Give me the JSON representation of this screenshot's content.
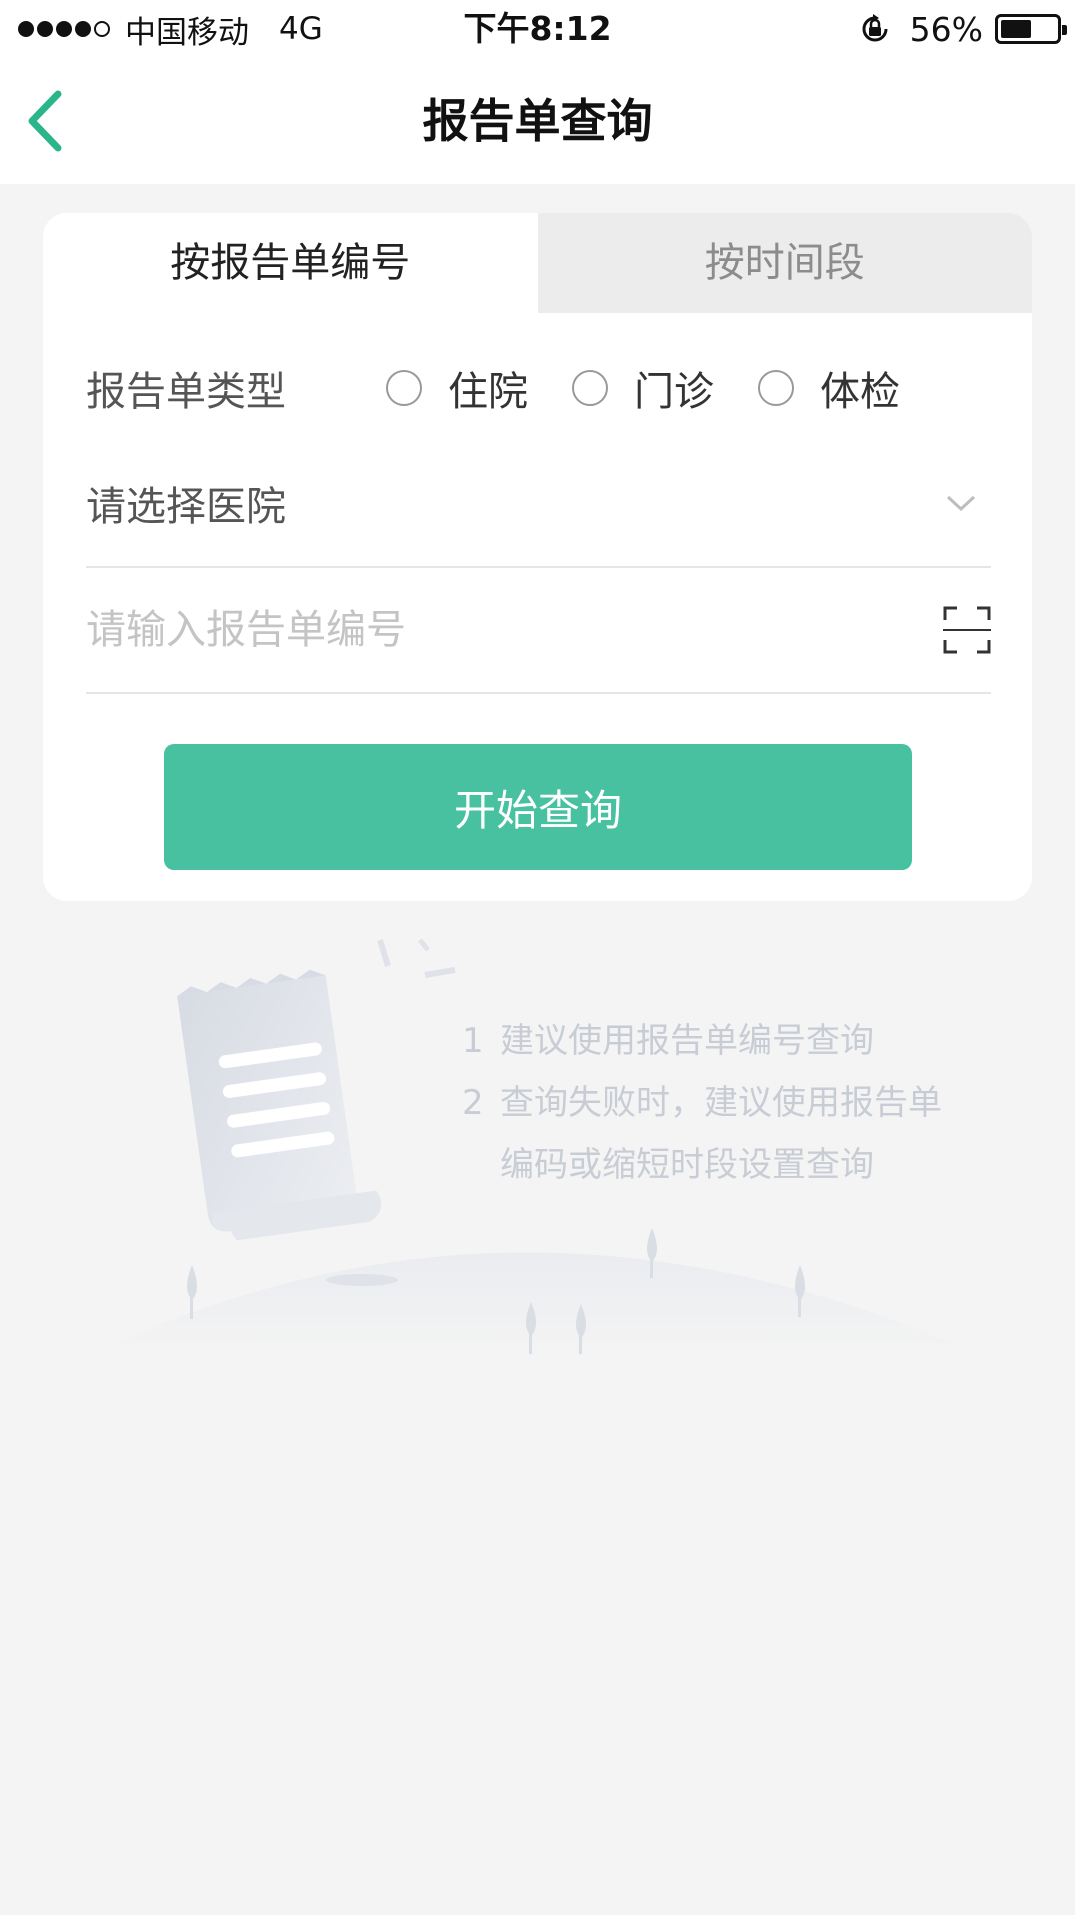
{
  "status_bar": {
    "carrier": "中国移动",
    "network": "4G",
    "time": "下午8:12",
    "battery": "56%",
    "battery_level": 0.56
  },
  "nav": {
    "title": "报告单查询",
    "back_icon": "chevron-left-icon",
    "accent_color": "#2bb58a"
  },
  "tabs": [
    {
      "label": "按报告单编号",
      "active": true
    },
    {
      "label": "按时间段",
      "active": false
    }
  ],
  "form": {
    "type_label": "报告单类型",
    "type_options": [
      "住院",
      "门诊",
      "体检"
    ],
    "hospital_placeholder": "请选择医院",
    "number_placeholder": "请输入报告单编号",
    "submit_label": "开始查询",
    "button_color": "#47c19f"
  },
  "tips": {
    "items": [
      {
        "num": "1",
        "text": "建议使用报告单编号查询"
      },
      {
        "num": "2",
        "text": "查询失败时，建议使用报告单",
        "cont": "编码或缩短时段设置查询"
      }
    ]
  }
}
